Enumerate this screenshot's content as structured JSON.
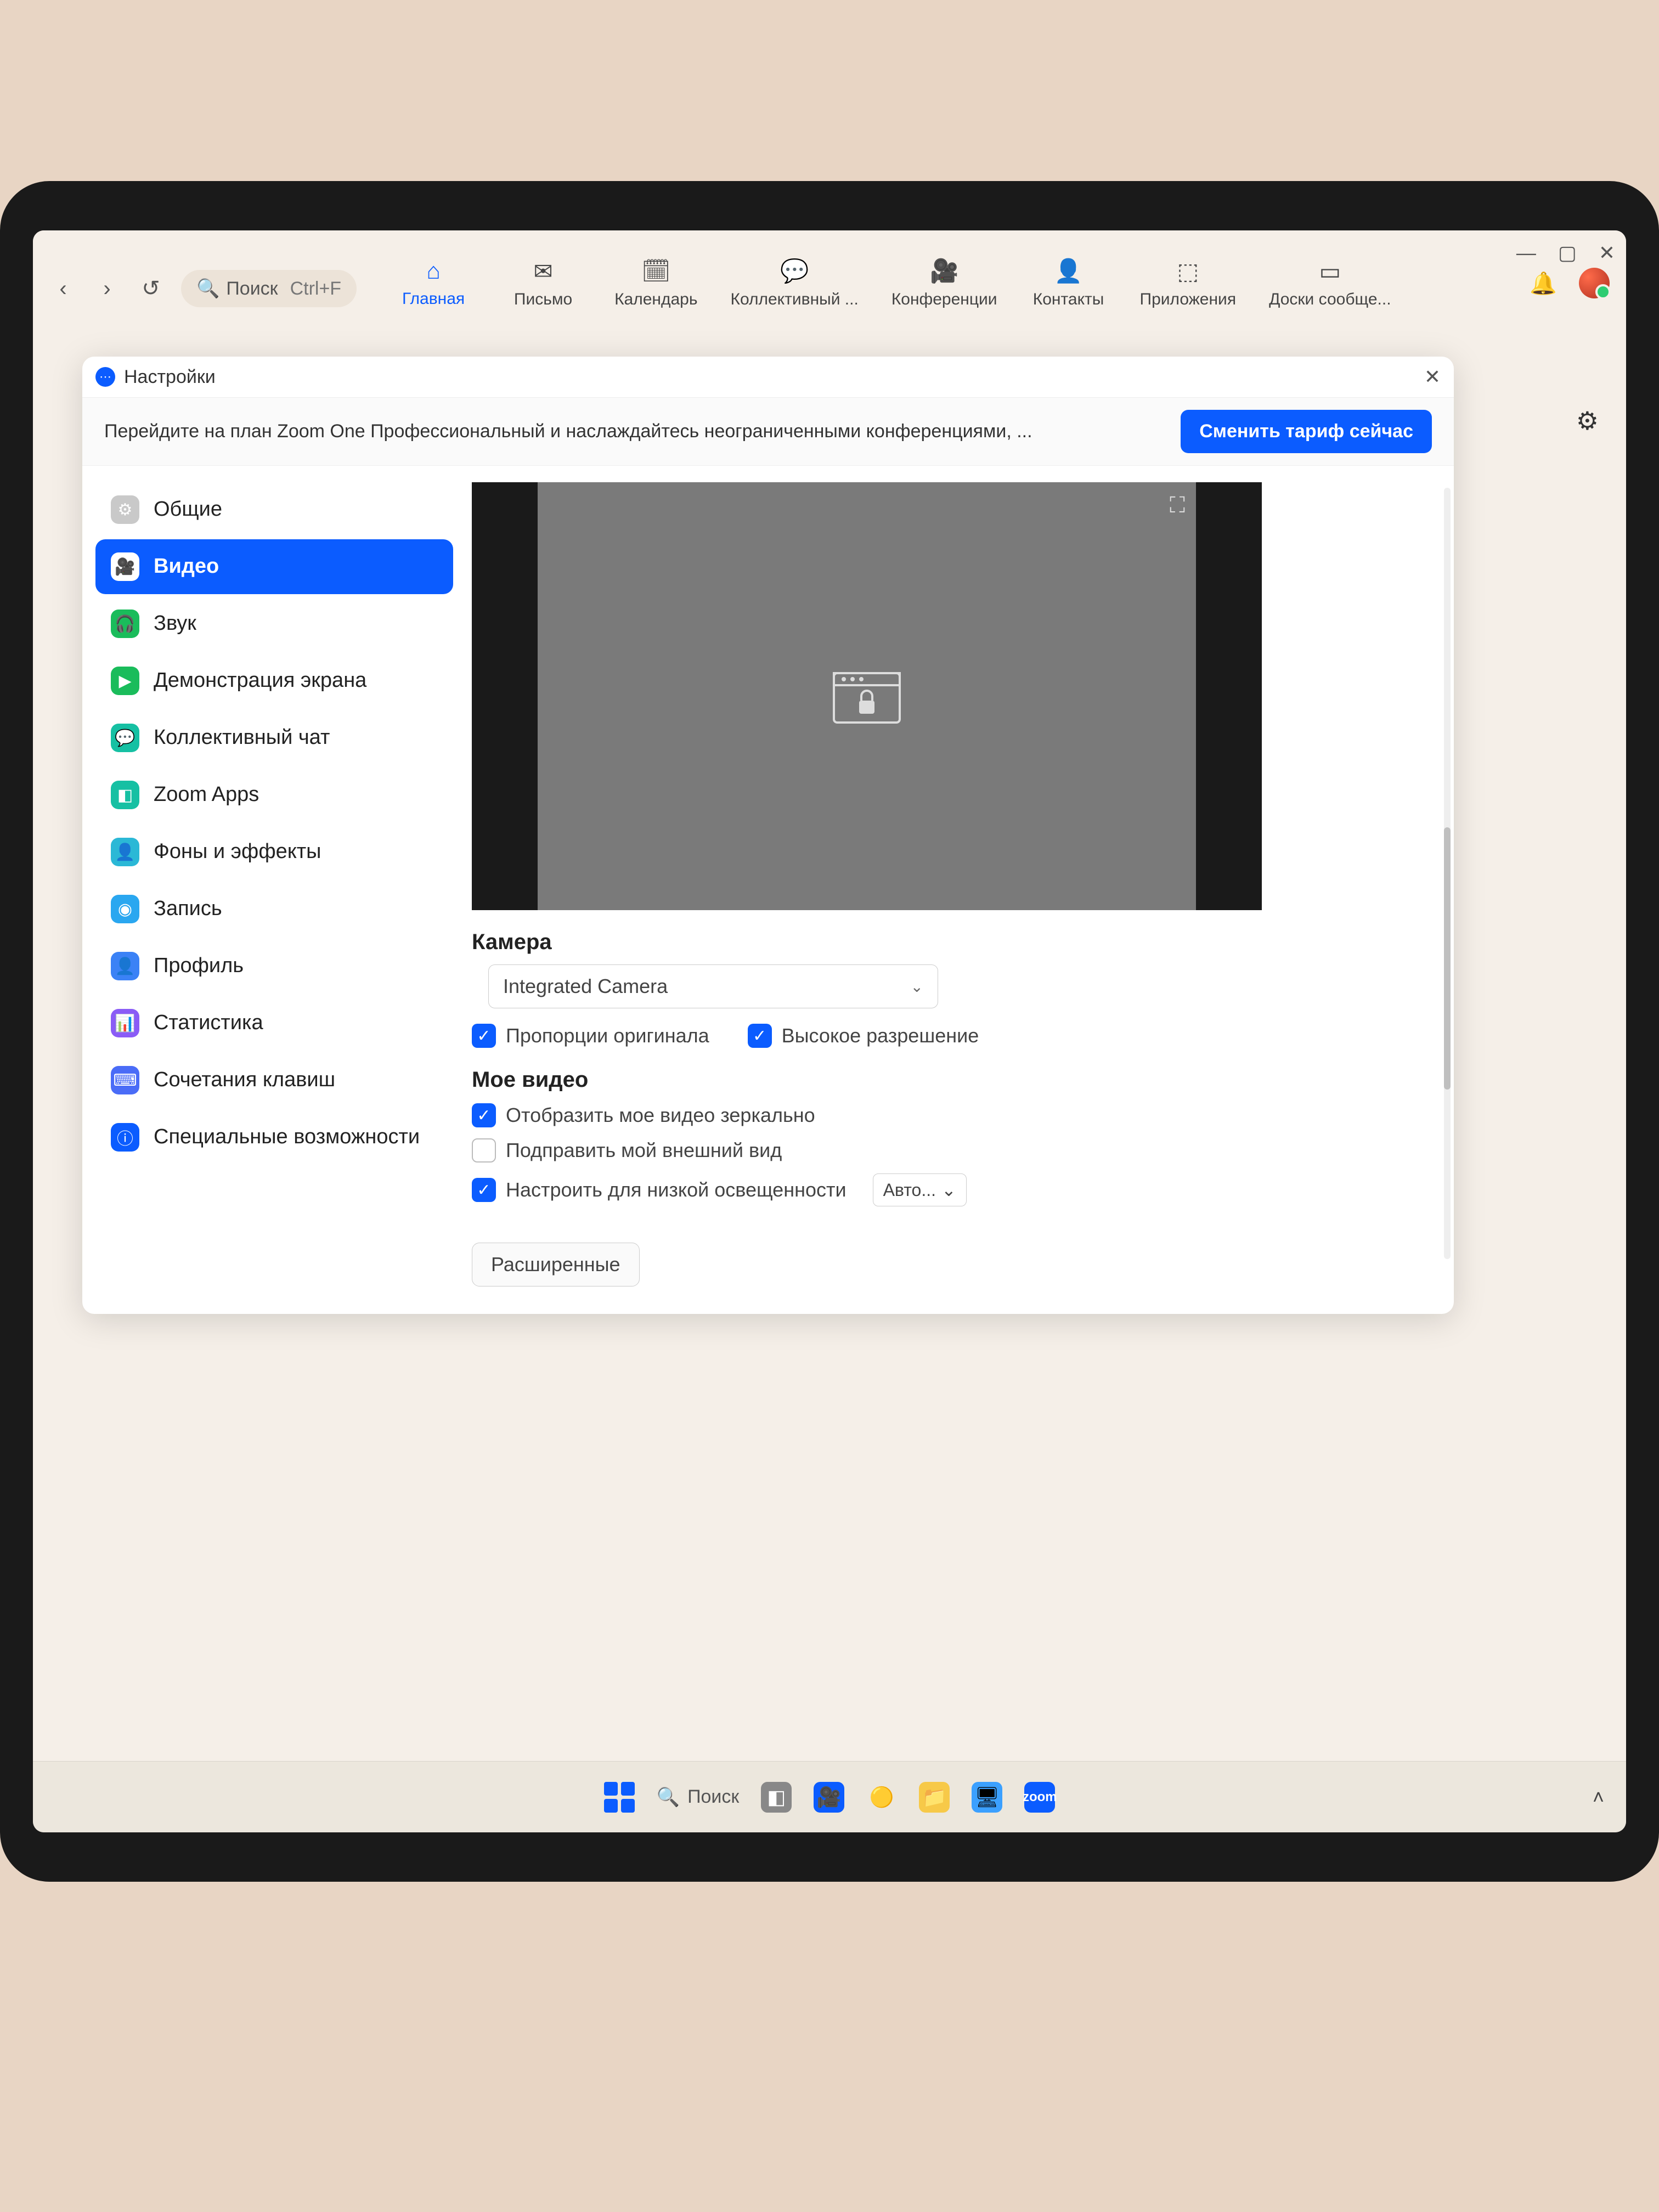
{
  "toolbar": {
    "search_placeholder": "Поиск",
    "search_shortcut": "Ctrl+F",
    "tabs": [
      {
        "label": "Главная"
      },
      {
        "label": "Письмо"
      },
      {
        "label": "Календарь"
      },
      {
        "label": "Коллективный ..."
      },
      {
        "label": "Конференции"
      },
      {
        "label": "Контакты"
      },
      {
        "label": "Приложения"
      },
      {
        "label": "Доски сообще..."
      }
    ]
  },
  "settings": {
    "title": "Настройки",
    "promo_text": "Перейдите на план Zoom One Профессиональный и наслаждайтесь неограниченными конференциями, ...",
    "promo_button": "Сменить тариф сейчас",
    "nav": [
      {
        "label": "Общие"
      },
      {
        "label": "Видео"
      },
      {
        "label": "Звук"
      },
      {
        "label": "Демонстрация экрана"
      },
      {
        "label": "Коллективный чат"
      },
      {
        "label": "Zoom Apps"
      },
      {
        "label": "Фоны и эффекты"
      },
      {
        "label": "Запись"
      },
      {
        "label": "Профиль"
      },
      {
        "label": "Статистика"
      },
      {
        "label": "Сочетания клавиш"
      },
      {
        "label": "Специальные возможности"
      }
    ],
    "camera_section": "Камера",
    "camera_selected": "Integrated Camera",
    "checks": {
      "original_ratio": "Пропорции оригинала",
      "high_res": "Высокое разрешение"
    },
    "myvideo_section": "Мое видео",
    "myvideo": {
      "mirror": "Отобразить мое видео зеркально",
      "touchup": "Подправить мой внешний вид",
      "lowlight": "Настроить для низкой освещенности",
      "lowlight_mode": "Авто..."
    },
    "advanced_button": "Расширенные"
  },
  "taskbar": {
    "search": "Поиск"
  }
}
